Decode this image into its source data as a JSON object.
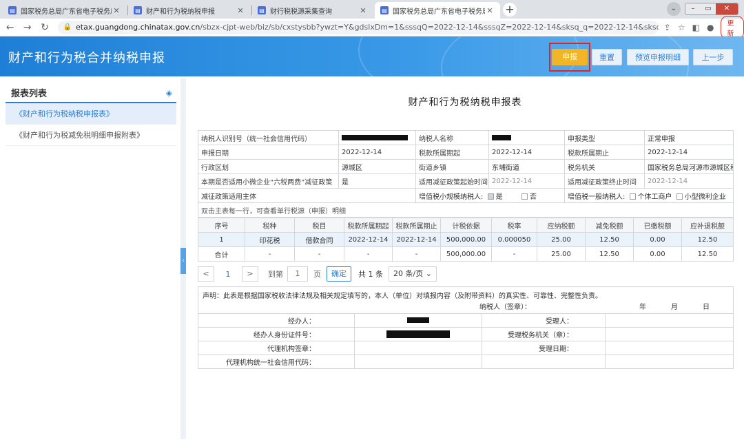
{
  "browser": {
    "tabs": [
      {
        "title": "国家税务总局广东省电子税务局",
        "active": false
      },
      {
        "title": "财产和行为税纳税申报",
        "active": false
      },
      {
        "title": "财行税税源采集查询",
        "active": false
      },
      {
        "title": "国家税务总局广东省电子税务局",
        "active": true
      }
    ],
    "url_host": "etax.guangdong.chinatax.gov.cn",
    "url_rest": "/sbzx-cjpt-web/biz/sb/cxstysbb?ywzt=Y&gdslxDm=1&sssqQ=2022-12-14&sssqZ=2022-12-14&sksq_q=2022-12-14&sksq_z...",
    "update_label": "更新"
  },
  "header": {
    "title": "财产和行为税合并纳税申报",
    "buttons": {
      "declare": "申报",
      "reset": "重置",
      "preview": "预览申报明细",
      "back": "上一步"
    }
  },
  "sidebar": {
    "title": "报表列表",
    "items": [
      {
        "label": "《财产和行为税纳税申报表》",
        "active": true
      },
      {
        "label": "《财产和行为税减免税明细申报附表》",
        "active": false
      }
    ]
  },
  "form": {
    "title": "财产和行为税纳税申报表",
    "info": {
      "taxpayer_id_label": "纳税人识别号（统一社会信用代码）",
      "taxpayer_name_label": "纳税人名称",
      "declare_type_label": "申报类型",
      "declare_type_value": "正常申报",
      "declare_date_label": "申报日期",
      "declare_date_value": "2022-12-14",
      "period_start_label": "税款所属期起",
      "period_start_value": "2022-12-14",
      "period_end_label": "税款所属期止",
      "period_end_value": "2022-12-14",
      "district_label": "行政区划",
      "district_value": "源城区",
      "street_label": "街道乡镇",
      "street_value": "东埔街道",
      "tax_office_label": "税务机关",
      "tax_office_value": "国家税务总局河源市源城区税务",
      "policy_label": "本期是否适用小微企业“六税两费”减征政策",
      "policy_value": "是",
      "policy_start_label": "适用减征政策起始时间",
      "policy_start_value": "2022-12-14",
      "policy_end_label": "适用减征政策终止时间",
      "policy_end_value": "2022-12-14",
      "subject_label": "减征政策适用主体",
      "small_scale_label": "增值税小规模纳税人:",
      "yes_label": "是",
      "no_label": "否",
      "general_label": "增值税一般纳税人:",
      "individual_label": "个体工商户",
      "micro_label": "小型微利企业",
      "hint": "双击主表每一行，可查看单行税源（申报）明细"
    },
    "columns": [
      "序号",
      "税种",
      "税目",
      "税款所属期起",
      "税款所属期止",
      "计税依据",
      "税率",
      "应纳税额",
      "减免税额",
      "已缴税额",
      "应补退税额"
    ],
    "rows": [
      [
        "1",
        "印花税",
        "借款合同",
        "2022-12-14",
        "2022-12-14",
        "500,000.00",
        "0.000050",
        "25.00",
        "12.50",
        "0.00",
        "12.50"
      ],
      [
        "合计",
        "-",
        "-",
        "-",
        "-",
        "500,000.00",
        "-",
        "25.00",
        "12.50",
        "0.00",
        "12.50"
      ]
    ],
    "pager": {
      "prev": "<",
      "current": "1",
      "next": ">",
      "goto_label": "到第",
      "goto_value": "1",
      "page_label": "页",
      "confirm": "确定",
      "total": "共 1 条",
      "size": "20 条/页"
    },
    "declaration": {
      "statement": "声明：此表是根据国家税收法律法规及相关规定填写的，本人（单位）对填报内容（及附带资料）的真实性、可靠性、完整性负责。",
      "signer": "纳税人（签章）：",
      "year": "年",
      "month": "月",
      "day": "日",
      "agent_label": "经办人：",
      "receiver_label": "受理人：",
      "agent_id_label": "经办人身份证件号：",
      "receiver_office_label": "受理税务机关（章）：",
      "agency_seal_label": "代理机构签章：",
      "receive_date_label": "受理日期：",
      "agency_code_label": "代理机构统一社会信用代码："
    }
  },
  "colors": {
    "header_blue": "#2f8ae0",
    "primary_yellow": "#f3b528",
    "highlight_red": "#e02323",
    "link_blue": "#2f7fd1"
  }
}
